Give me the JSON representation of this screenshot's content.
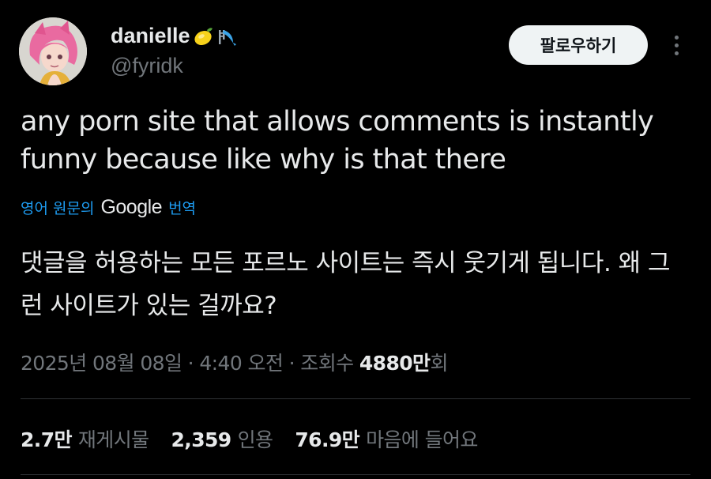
{
  "author": {
    "display_name": "danielle",
    "handle": "@fyridk",
    "name_emojis": [
      "lemon-icon",
      "slide-icon"
    ]
  },
  "follow_button": {
    "label": "팔로우하기"
  },
  "more_button": {
    "icon": "more-vertical-icon"
  },
  "tweet": {
    "text": "any porn site that allows comments is instantly funny because like why is that there",
    "translation": {
      "prefix": "영어 원문의",
      "brand": "Google",
      "suffix": "번역",
      "text": "댓글을 허용하는 모든 포르노 사이트는 즉시 웃기게 됩니다. 왜 그런 사이트가 있는 걸까요?"
    }
  },
  "meta": {
    "timestamp": "2025년 08월 08일 · 4:40 오전 · 조회수 ",
    "views_number": "4880만",
    "views_suffix": "회"
  },
  "stats": {
    "reposts_count": "2.7만",
    "reposts_label": "재게시물",
    "quotes_count": "2,359",
    "quotes_label": "인용",
    "likes_count": "76.9만",
    "likes_label": "마음에 들어요"
  },
  "colors": {
    "background": "#000000",
    "text_primary": "#e7e9ea",
    "text_secondary": "#71767b",
    "link": "#1d9bf0",
    "button_bg": "#eff3f4"
  }
}
